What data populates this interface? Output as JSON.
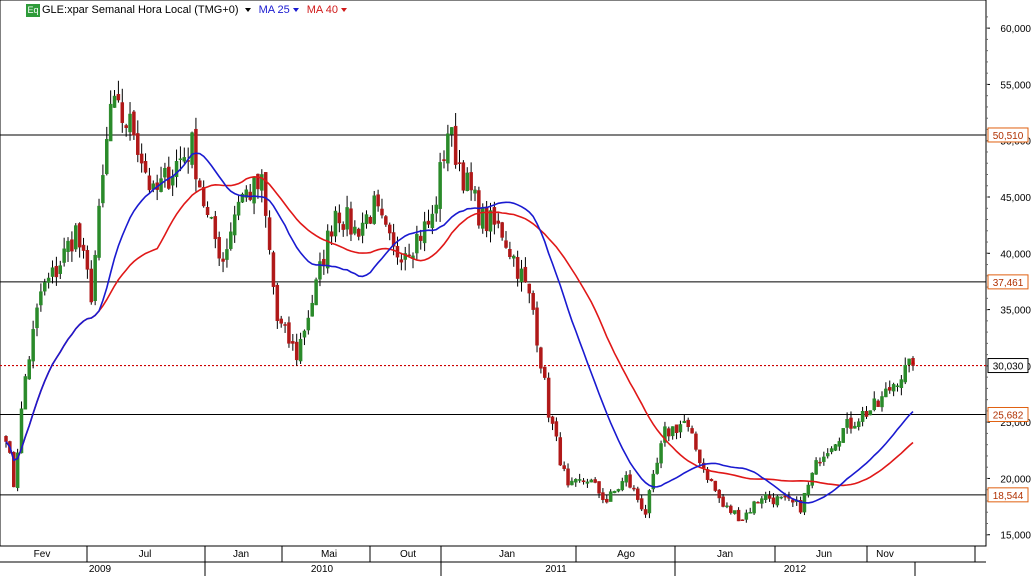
{
  "header": {
    "symbol_icon": "Eq",
    "title": "GLE:xpar Semanal Hora Local (TMG+0)",
    "ma1_label": "MA 25",
    "ma2_label": "MA 40"
  },
  "colors": {
    "up_candle": "#2a8a2a",
    "down_candle": "#b01818",
    "ma25": "#1a1ad0",
    "ma40": "#e01818",
    "level_line": "#000000",
    "price_line": "#cc0000",
    "label_border": "#e06010",
    "label_text": "#b03000"
  },
  "chart_data": {
    "type": "candlestick",
    "y_ticks": [
      "15,000",
      "20,000",
      "25,000",
      "30,000",
      "35,000",
      "40,000",
      "45,000",
      "50,000",
      "55,000",
      "60,000"
    ],
    "ylim": [
      14000,
      62500
    ],
    "months": [
      "Fev",
      "Jul",
      "Jan",
      "Mai",
      "Out",
      "Jan",
      "Ago",
      "Jan",
      "Jun",
      "Nov"
    ],
    "years": [
      "2009",
      "2010",
      "2011",
      "2012"
    ],
    "horizontal_levels": [
      {
        "label": "50,510",
        "value": 50510
      },
      {
        "label": "37,461",
        "value": 37461
      },
      {
        "label": "25,682",
        "value": 25682
      },
      {
        "label": "18,544",
        "value": 18544
      }
    ],
    "last_price": {
      "label": "30,030",
      "value": 30030
    },
    "close_anchors": [
      [
        0,
        24000
      ],
      [
        2,
        19500
      ],
      [
        5,
        29000
      ],
      [
        9,
        36500
      ],
      [
        13,
        38500
      ],
      [
        18,
        42000
      ],
      [
        22,
        36500
      ],
      [
        27,
        53000
      ],
      [
        33,
        51000
      ],
      [
        38,
        45000
      ],
      [
        44,
        48000
      ],
      [
        48,
        49500
      ],
      [
        52,
        43000
      ],
      [
        56,
        39500
      ],
      [
        60,
        45000
      ],
      [
        66,
        46000
      ],
      [
        70,
        34000
      ],
      [
        75,
        31000
      ],
      [
        80,
        37000
      ],
      [
        85,
        44000
      ],
      [
        90,
        42000
      ],
      [
        95,
        44000
      ],
      [
        100,
        40000
      ],
      [
        105,
        41000
      ],
      [
        110,
        43000
      ],
      [
        114,
        51000
      ],
      [
        119,
        46000
      ],
      [
        123,
        43000
      ],
      [
        128,
        42000
      ],
      [
        133,
        38000
      ],
      [
        136,
        35000
      ],
      [
        140,
        26000
      ],
      [
        145,
        19000
      ],
      [
        150,
        20000
      ],
      [
        155,
        18000
      ],
      [
        160,
        20000
      ],
      [
        165,
        17000
      ],
      [
        170,
        24000
      ],
      [
        175,
        25000
      ],
      [
        180,
        21000
      ],
      [
        185,
        17500
      ],
      [
        190,
        16500
      ],
      [
        195,
        18500
      ],
      [
        200,
        18000
      ],
      [
        205,
        17500
      ],
      [
        210,
        22000
      ],
      [
        215,
        24000
      ],
      [
        220,
        25500
      ],
      [
        225,
        26500
      ],
      [
        230,
        29000
      ],
      [
        234,
        30030
      ]
    ]
  }
}
